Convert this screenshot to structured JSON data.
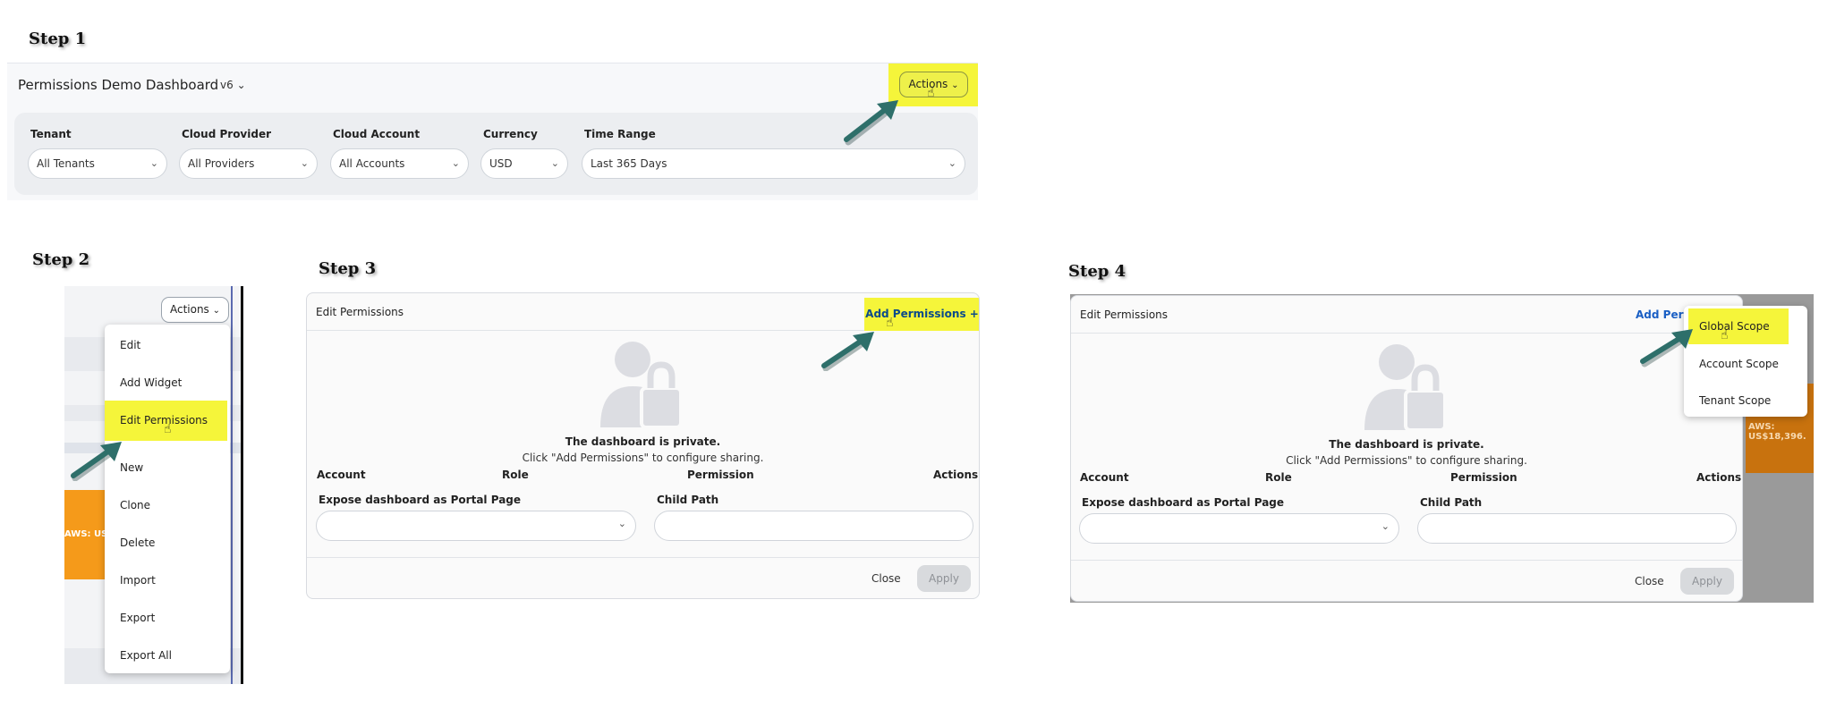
{
  "steps": {
    "s1": "Step 1",
    "s2": "Step 2",
    "s3": "Step 3",
    "s4": "Step 4"
  },
  "dashboard": {
    "title": "Permissions Demo Dashboard",
    "version": "v6",
    "actions_label": "Actions"
  },
  "filters": [
    {
      "label": "Tenant",
      "value": "All Tenants"
    },
    {
      "label": "Cloud Provider",
      "value": "All Providers"
    },
    {
      "label": "Cloud Account",
      "value": "All Accounts"
    },
    {
      "label": "Currency",
      "value": "USD"
    },
    {
      "label": "Time Range",
      "value": "Last 365 Days"
    }
  ],
  "actions_menu": {
    "button_label": "Actions",
    "items": [
      "Edit",
      "Add Widget",
      "Edit Permissions",
      "New",
      "Clone",
      "Delete",
      "Import",
      "Export",
      "Export All"
    ],
    "background_label": "AWS: US$"
  },
  "edit_permissions": {
    "title": "Edit Permissions",
    "add_permissions": "Add Permissions +",
    "add_permissions_truncated": "Add Perm",
    "private_title": "The dashboard is private.",
    "private_hint": "Click \"Add Permissions\" to configure sharing.",
    "columns": [
      "Account",
      "Role",
      "Permission",
      "Actions"
    ],
    "portal_label": "Expose dashboard as Portal Page",
    "child_path_label": "Child Path",
    "close": "Close",
    "apply": "Apply"
  },
  "scope_menu": {
    "items": [
      "Global Scope",
      "Account Scope",
      "Tenant Scope"
    ],
    "background_label": "AWS: US$18,396."
  },
  "colors": {
    "highlight": "#f5f53a",
    "arrow": "#2e6f6a",
    "orange": "#f59a1a",
    "link": "#1a5fc4"
  }
}
